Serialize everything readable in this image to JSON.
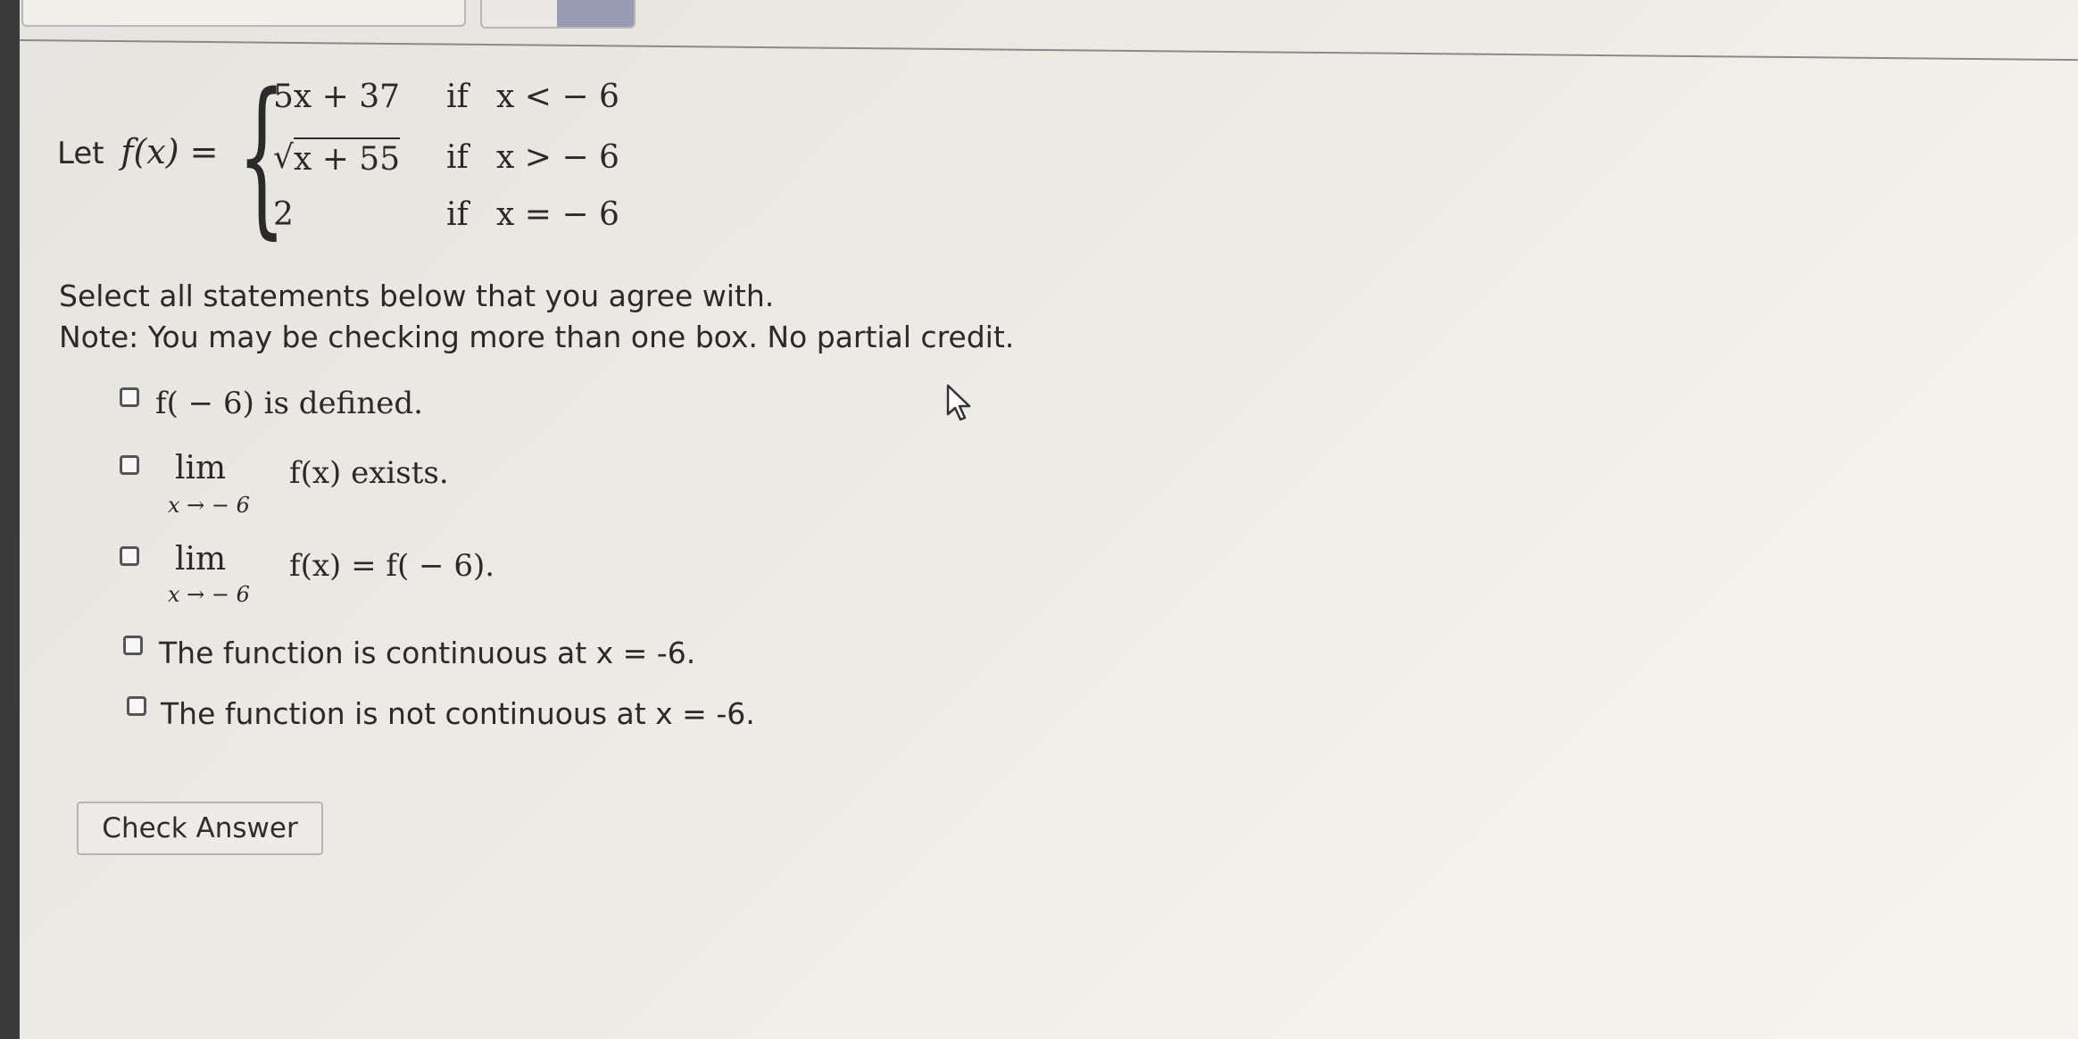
{
  "function_def": {
    "let_label": "Let",
    "fx": "f(x) =",
    "cases": [
      {
        "expr": "5x + 37",
        "if_word": "if",
        "cond": "x < − 6"
      },
      {
        "expr": "x + 55",
        "if_word": "if",
        "cond": "x > − 6",
        "radical": "√"
      },
      {
        "expr": "2",
        "if_word": "if",
        "cond": "x = − 6"
      }
    ]
  },
  "prompt": {
    "line1": "Select all statements below that you agree with.",
    "line2": "Note: You may be checking more than one box. No partial credit."
  },
  "options": [
    {
      "label": "f( − 6) is defined.",
      "checked": false
    },
    {
      "lim": "lim",
      "sub": "x → − 6",
      "label": "f(x) exists.",
      "checked": false
    },
    {
      "lim": "lim",
      "sub": "x → − 6",
      "label": "f(x) = f( − 6).",
      "checked": false
    },
    {
      "label": "The function is continuous at x = -6.",
      "checked": false
    },
    {
      "label": "The function is not continuous at x = -6.",
      "checked": false
    }
  ],
  "check_button": {
    "label": "Check Answer"
  },
  "icons": {
    "cursor": "mouse-pointer-icon"
  }
}
